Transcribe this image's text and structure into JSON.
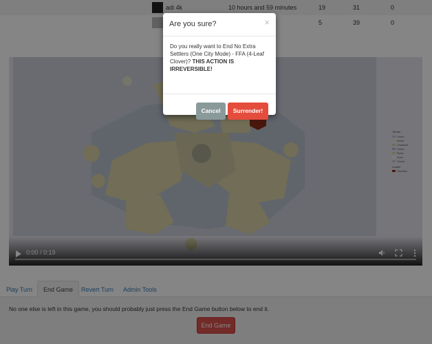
{
  "players": [
    {
      "name": "adi 4k",
      "time": "10 hours and 59 minutes",
      "v1": "19",
      "v2": "31",
      "v3": "0"
    },
    {
      "name": "",
      "time": "nutes",
      "v1": "5",
      "v2": "39",
      "v3": "0"
    }
  ],
  "video": {
    "time_display": "0:00 / 0:19",
    "progress": 0,
    "legend": {
      "terrain_title": "Terrain",
      "terrain_items": [
        "Ocean",
        "Desert",
        "Grassland",
        "Ocean",
        "Plains",
        "Snow",
        "Tundra"
      ],
      "leader_title": "Leader",
      "leader_items": [
        "Tlaxcalan"
      ]
    }
  },
  "tabs": [
    {
      "label": "Play Turn",
      "active": false
    },
    {
      "label": "End Game",
      "active": true
    },
    {
      "label": "Revert Turn",
      "active": false
    },
    {
      "label": "Admin Tools",
      "active": false
    }
  ],
  "panel": {
    "message": "No one else is left in this game, you should probably just press the End Game button below to end it.",
    "end_game_label": "End Game"
  },
  "modal": {
    "title": "Are you sure?",
    "close_symbol": "×",
    "body_text": "Do you really want to End No Extra Settlers (One City Mode) - FFA (4-Leaf Clover)?",
    "body_warning": "THIS ACTION IS IRREVERSIBLE!",
    "cancel_label": "Cancel",
    "surrender_label": "Surrender!"
  },
  "colors": {
    "danger": "#d9534f",
    "surrender": "#e44c3c",
    "cancel": "#8a9a9b",
    "map_land": "#d8d2a6",
    "map_ocean": "#b9c1cf",
    "map_player": "#8e2c1a"
  },
  "icons": [
    "play-icon",
    "volume-icon",
    "fullscreen-icon",
    "more-options-icon",
    "close-icon"
  ]
}
